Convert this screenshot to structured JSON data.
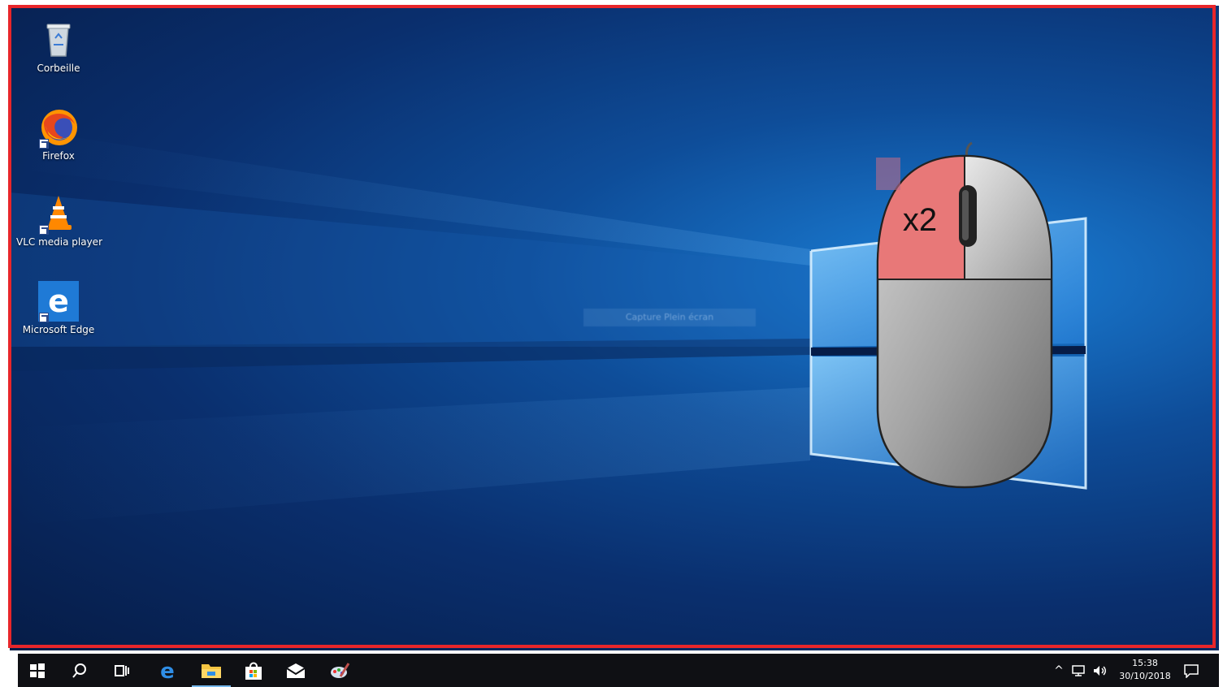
{
  "desktop": {
    "icons": [
      {
        "label": "Corbeille",
        "icon": "recycle-bin-icon"
      },
      {
        "label": "Firefox",
        "icon": "firefox-icon"
      },
      {
        "label": "VLC media player",
        "icon": "vlc-icon"
      },
      {
        "label": "Microsoft Edge",
        "icon": "edge-icon"
      }
    ],
    "blurred_text": "Capture Plein écran"
  },
  "mouse_overlay": {
    "click_label": "x2",
    "highlight_color": "#e87878",
    "meaning": "double-click left button"
  },
  "taskbar": {
    "buttons": [
      {
        "icon": "windows-start-icon"
      },
      {
        "icon": "search-icon"
      },
      {
        "icon": "task-view-icon"
      },
      {
        "icon": "edge-icon"
      },
      {
        "icon": "file-explorer-icon",
        "active": true
      },
      {
        "icon": "store-icon"
      },
      {
        "icon": "mail-icon"
      },
      {
        "icon": "paint-icon"
      }
    ],
    "tray": {
      "chevron": "^",
      "time": "15:38",
      "date": "30/10/2018"
    }
  },
  "colors": {
    "frame": "#e8262a",
    "taskbar": "#0f1014",
    "accent": "#76b9ed"
  }
}
